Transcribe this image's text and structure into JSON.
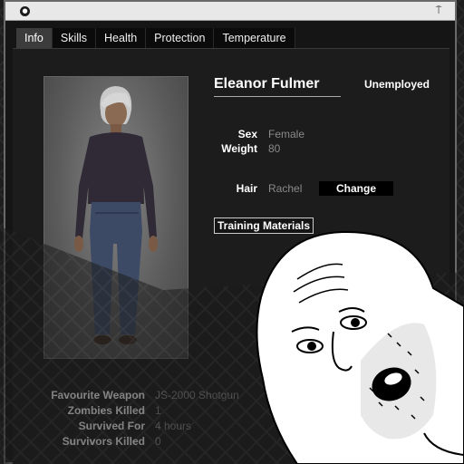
{
  "tabs": [
    {
      "label": "Info"
    },
    {
      "label": "Skills"
    },
    {
      "label": "Health"
    },
    {
      "label": "Protection"
    },
    {
      "label": "Temperature"
    }
  ],
  "character": {
    "name": "Eleanor Fulmer",
    "occupation": "Unemployed",
    "sex_label": "Sex",
    "sex": "Female",
    "weight_label": "Weight",
    "weight": "80",
    "hair_label": "Hair",
    "hair": "Rachel",
    "change_label": "Change",
    "training_label": "Training Materials"
  },
  "stats": {
    "favourite_weapon_label": "Favourite Weapon",
    "favourite_weapon": "JS-2000 Shotgun",
    "zombies_killed_label": "Zombies Killed",
    "zombies_killed": "1",
    "survived_for_label": "Survived For",
    "survived_for": "4 hours",
    "survivors_killed_label": "Survivors Killed",
    "survivors_killed": "0"
  },
  "colors": {
    "window_bg": "#151515",
    "panel_bg": "#1c1c1c",
    "active_tab": "#3c3c3c",
    "muted_text": "#8a8a8a"
  },
  "icons": {
    "close": "close-icon",
    "pin": "pin-icon"
  }
}
